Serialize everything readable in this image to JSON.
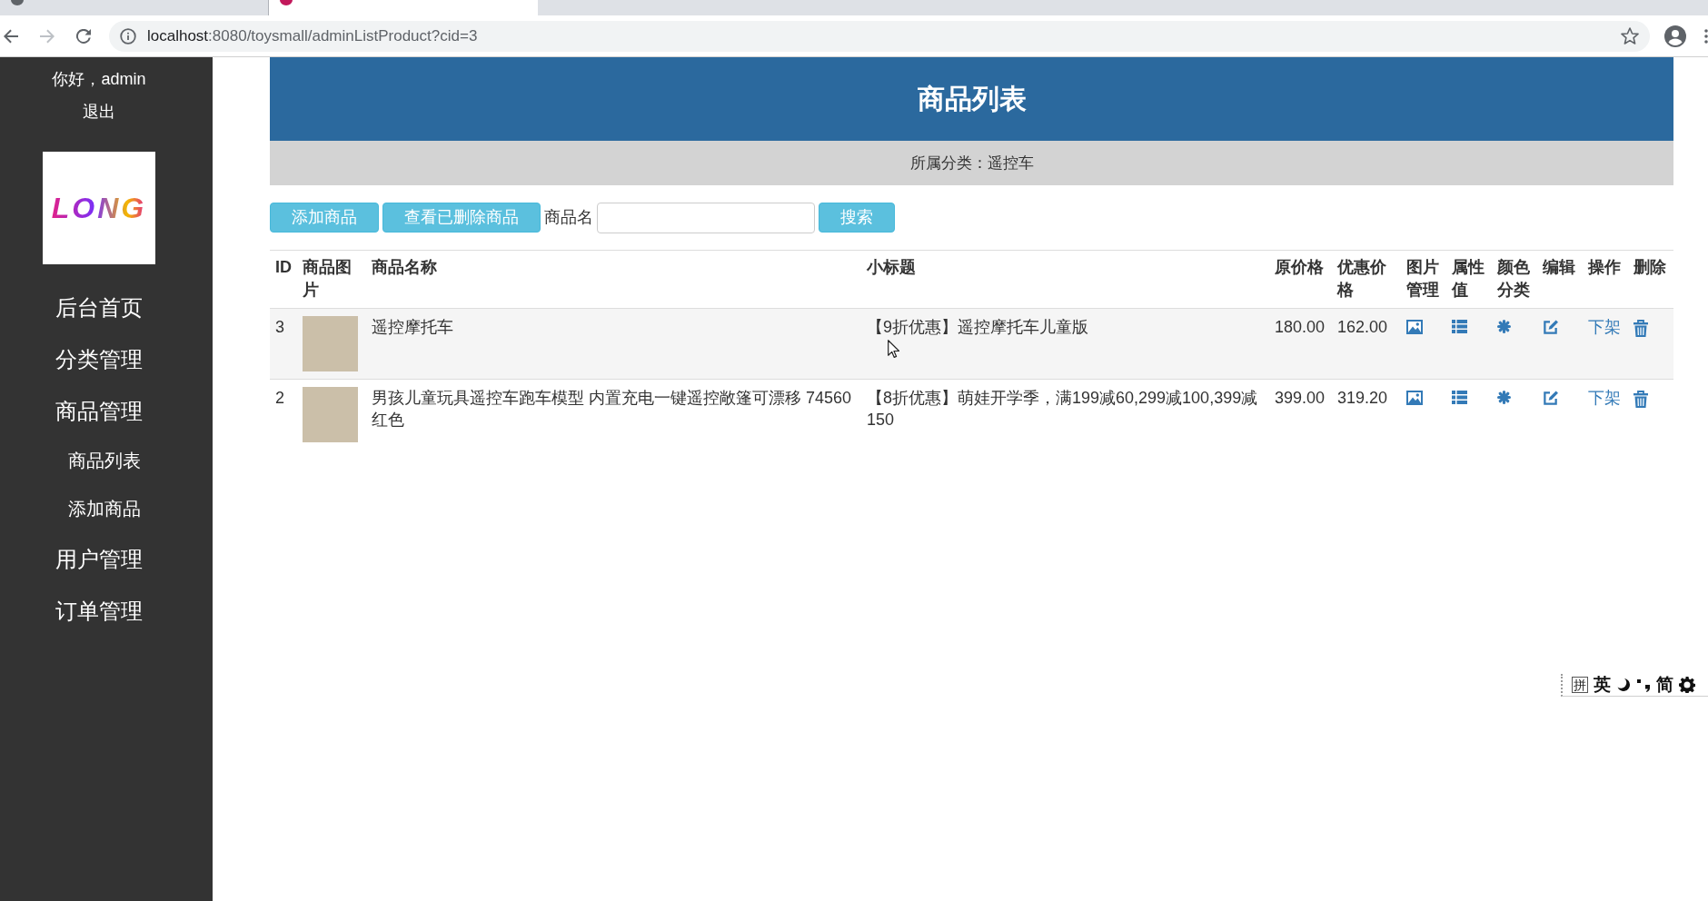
{
  "browser": {
    "tabs": [
      {
        "selected": false
      },
      {
        "selected": true
      }
    ],
    "nav_buttons": [
      {
        "kind": "back",
        "disabled": false
      },
      {
        "kind": "forward",
        "disabled": true
      },
      {
        "kind": "reload",
        "disabled": false
      }
    ],
    "url": "localhost:8080/toysmall/adminListProduct?cid=3"
  },
  "sidebar": {
    "greeting": "你好，admin",
    "logout": "退出",
    "logo": "LONG",
    "menu": [
      {
        "label": "后台首页",
        "kind": "main"
      },
      {
        "label": "分类管理",
        "kind": "main"
      },
      {
        "label": "商品管理",
        "kind": "main"
      },
      {
        "label": "商品列表",
        "kind": "sub"
      },
      {
        "label": "添加商品",
        "kind": "sub"
      },
      {
        "label": "用户管理",
        "kind": "main"
      },
      {
        "label": "订单管理",
        "kind": "main"
      }
    ]
  },
  "header": {
    "title": "商品列表",
    "category": "所属分类：遥控车"
  },
  "toolbar": {
    "buttons": [
      "添加商品",
      "查看已删除商品"
    ],
    "search_label": "商品名",
    "search_button": "搜索"
  },
  "table": {
    "columns": [
      "ID",
      "商品图片",
      "商品名称",
      "小标题",
      "原价格",
      "优惠价格",
      "图片管理",
      "属性值",
      "颜色分类",
      "编辑",
      "操作",
      "删除"
    ],
    "rows": [
      {
        "id": "3",
        "name": "遥控摩托车",
        "subtitle": "【9折优惠】遥控摩托车儿童版",
        "price": "180.00",
        "sale_price": "162.00",
        "action": "下架"
      },
      {
        "id": "2",
        "name": "男孩儿童玩具遥控车跑车模型 内置充电一键遥控敞篷可漂移 74560 红色",
        "subtitle": "【8折优惠】萌娃开学季，满199减60,299减100,399减150",
        "price": "399.00",
        "sale_price": "319.20",
        "action": "下架"
      }
    ]
  },
  "ime_toolbar": {
    "items": [
      {
        "kind": "boxed",
        "label": "拼"
      },
      {
        "kind": "text",
        "label": "英"
      },
      {
        "kind": "moon"
      },
      {
        "kind": "punct"
      },
      {
        "kind": "text",
        "label": "简"
      },
      {
        "kind": "gear"
      }
    ]
  }
}
